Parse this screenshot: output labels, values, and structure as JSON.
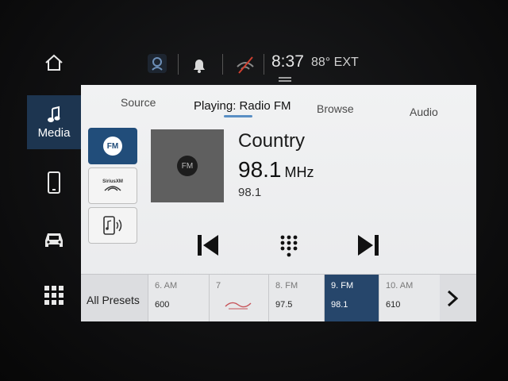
{
  "nav": {
    "items": [
      {
        "id": "home",
        "label": ""
      },
      {
        "id": "media",
        "label": "Media"
      },
      {
        "id": "phone",
        "label": ""
      },
      {
        "id": "vehicle",
        "label": ""
      },
      {
        "id": "apps",
        "label": ""
      }
    ]
  },
  "status": {
    "time": "8:37",
    "temp": "88° EXT"
  },
  "tabs": {
    "source": "Source",
    "playing": "Playing: Radio FM",
    "browse": "Browse",
    "audio": "Audio"
  },
  "sources": {
    "fm": "FM",
    "siriusxm": "SiriusXM"
  },
  "now_playing": {
    "art_label": "FM",
    "genre": "Country",
    "frequency": "98.1",
    "unit": "MHz",
    "sub_frequency": "98.1"
  },
  "presets": {
    "all_label": "All Presets",
    "items": [
      {
        "label": "6. AM",
        "value": "600",
        "active": false
      },
      {
        "label": "7",
        "value": "",
        "active": false
      },
      {
        "label": "8. FM",
        "value": "97.5",
        "active": false
      },
      {
        "label": "9. FM",
        "value": "98.1",
        "active": true
      },
      {
        "label": "10. AM",
        "value": "610",
        "active": false
      }
    ]
  },
  "colors": {
    "accent": "#214d7a",
    "active_preset": "#26466b",
    "rail_active": "#1d3550"
  }
}
